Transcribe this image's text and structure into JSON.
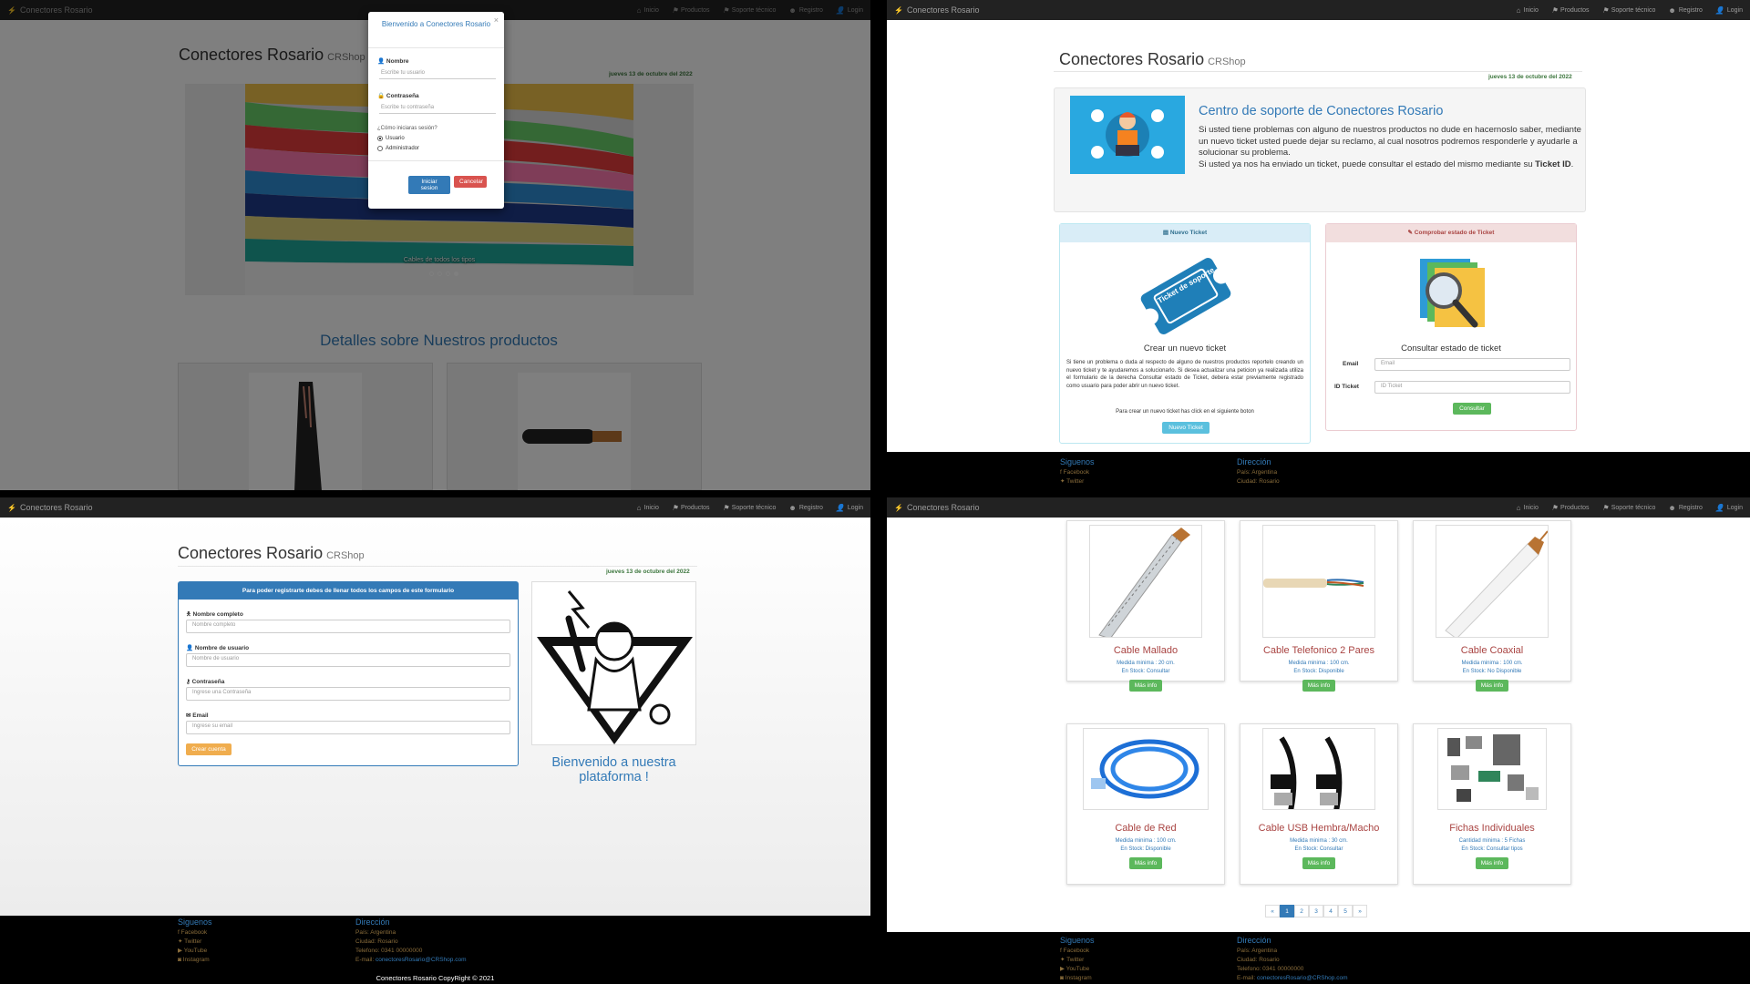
{
  "brand": "Conectores Rosario",
  "nav": {
    "inicio": "Inicio",
    "productos": "Productos",
    "soporte": "Soporte técnico",
    "registro": "Registro",
    "login": "Login"
  },
  "header": {
    "title": "Conectores Rosario",
    "subtitle": "CRShop",
    "date": "jueves 13 de octubre del 2022"
  },
  "home": {
    "carousel_caption": "Cables de todos los tipos",
    "details_title": "Detalles sobre Nuestros productos"
  },
  "login_modal": {
    "title": "Bienvenido a Conectores Rosario",
    "name_label": "Nombre",
    "name_placeholder": "Escribe tu usuario",
    "pass_label": "Contraseña",
    "pass_placeholder": "Escribe tu contraseña",
    "question": "¿Cómo iniciaras sesión?",
    "opt_user": "Usuario",
    "opt_admin": "Administrador",
    "login_btn": "Iniciar sesion",
    "cancel_btn": "Cancelar",
    "close": "×"
  },
  "support": {
    "title": "Centro de soporte de Conectores Rosario",
    "text1": "Si usted tiene problemas con alguno de nuestros productos no dude en hacernoslo saber, mediante un nuevo ticket usted puede dejar su reclamo, al cual nosotros podremos responderle y ayudarle a solucionar su problema.",
    "text2": "Si usted ya nos ha enviado un ticket, puede consultar el estado del mismo mediante su",
    "ticket_id": "Ticket ID",
    "new_ticket_header": "Nuevo Ticket",
    "ticket_img_text": "Ticket de soporte",
    "new_ticket_caption": "Crear un nuevo ticket",
    "new_ticket_body": "Si tiene un problema o duda al respecto de alguno de nuestros productos reportelo creando un nuevo ticket y te ayudaremos a solucionarlo. Si desea actualizar una peticion ya realizada utiliza el formulario de la derecha Consultar estado de Ticket, debera estar previamente registrado como usuario para poder abrir un nuevo ticket.",
    "new_ticket_cta": "Para crear un nuevo ticket has click en el siguiente boton",
    "new_ticket_btn": "Nuevo Ticket",
    "check_header": "Comprobar estado de Ticket",
    "check_caption": "Consultar estado de ticket",
    "email_label": "Email",
    "email_placeholder": "Email",
    "id_label": "ID Ticket",
    "id_placeholder": "ID Ticket",
    "consult_btn": "Consultar"
  },
  "register": {
    "header": "Para poder registrarte debes de llenar todos los campos de este formulario",
    "fullname_label": "Nombre completo",
    "fullname_placeholder": "Nombre completo",
    "user_label": "Nombre de usuario",
    "user_placeholder": "Nombre de usuario",
    "pass_label": "Contraseña",
    "pass_placeholder": "Ingrese una Contraseña",
    "email_label": "Email",
    "email_placeholder": "Ingrese su email",
    "create_btn": "Crear cuenta",
    "welcome": "Bienvenido a nuestra plataforma !"
  },
  "products": [
    {
      "name": "Cable Mallado",
      "line1": "Medida minima : 20 cm.",
      "line2": "En Stock: Consultar",
      "btn": "Más info"
    },
    {
      "name": "Cable Telefonico 2 Pares",
      "line1": "Medida minima : 100 cm.",
      "line2": "En Stock: Disponible",
      "btn": "Más info"
    },
    {
      "name": "Cable Coaxial",
      "line1": "Medida minima : 100 cm.",
      "line2": "En Stock: No Disponible",
      "btn": "Más info"
    },
    {
      "name": "Cable de Red",
      "line1": "Medida minima : 100 cm.",
      "line2": "En Stock: Disponible",
      "btn": "Más info"
    },
    {
      "name": "Cable USB Hembra/Macho",
      "line1": "Medida minima : 30 cm.",
      "line2": "En Stock: Consultar",
      "btn": "Más info"
    },
    {
      "name": "Fichas Individuales",
      "line1": "Cantidad minima : 5 Fichas",
      "line2": "En Stock: Consultar tipos",
      "btn": "Más info"
    }
  ],
  "pagination": [
    "«",
    "1",
    "2",
    "3",
    "4",
    "5",
    "»"
  ],
  "footer": {
    "follow_title": "Siguenos",
    "facebook": "Facebook",
    "twitter": "Twitter",
    "youtube": "YouTube",
    "instagram": "Instagram",
    "address_title": "Dirección",
    "pais": "País: Argentina",
    "ciudad": "Ciudad: Rosario",
    "telefono": "Telefono: 0341 00000000",
    "email_prefix": "E-mail:",
    "email": "conectoresRosario@CRShop.com",
    "copyright": "Conectores Rosario CopyRight © 2021"
  },
  "colors": {
    "navbar": "#222222",
    "primary": "#337ab7",
    "success": "#5cb85c",
    "danger": "#d9534f",
    "warning": "#f0ad4e",
    "info": "#5bc0de",
    "product_title": "#a94442"
  }
}
